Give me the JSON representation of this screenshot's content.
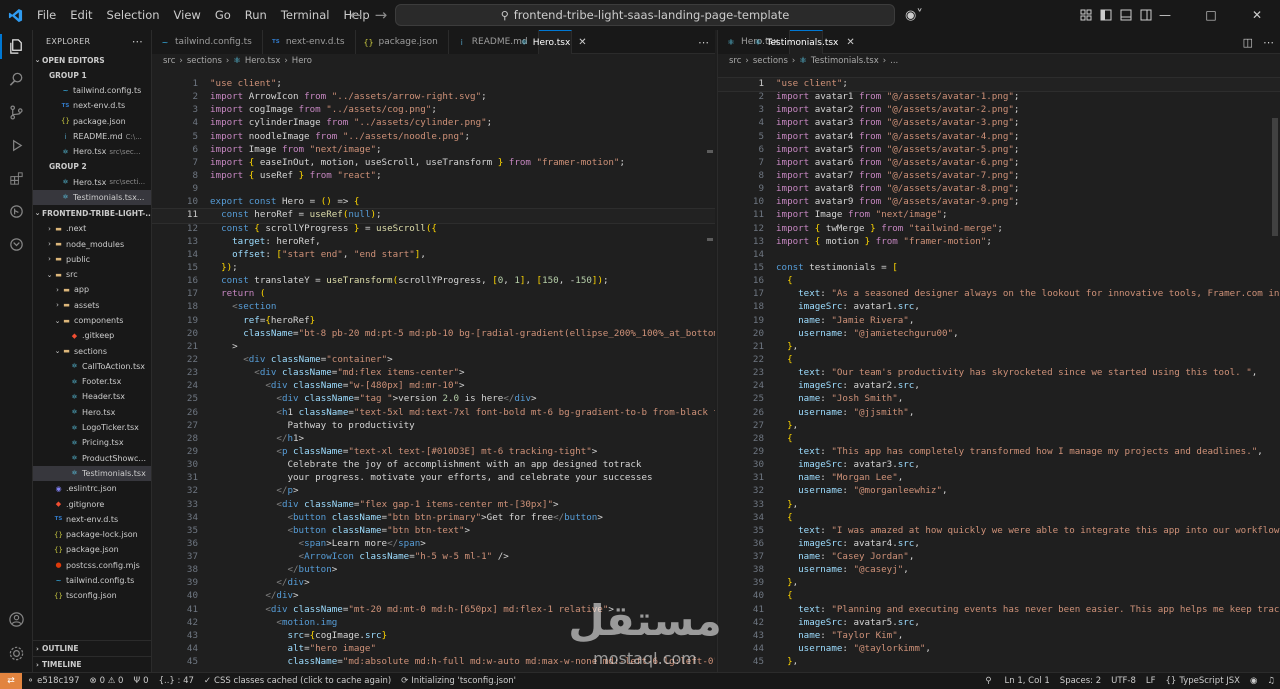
{
  "title_bar": {
    "menu": [
      "File",
      "Edit",
      "Selection",
      "View",
      "Go",
      "Run",
      "Terminal",
      "Help"
    ],
    "search_text": "frontend-tribe-light-saas-landing-page-template"
  },
  "explorer": {
    "title": "EXPLORER",
    "open_editors_label": "OPEN EDITORS",
    "group1_label": "GROUP 1",
    "group2_label": "GROUP 2",
    "project_label": "FRONTEND-TRIBE-LIGHT-...",
    "outline_label": "OUTLINE",
    "timeline_label": "TIMELINE",
    "group1": [
      {
        "name": "tailwind.config.ts",
        "desc": "",
        "icon": "tailwind-icon"
      },
      {
        "name": "next-env.d.ts",
        "desc": "",
        "icon": "typescript-icon"
      },
      {
        "name": "package.json",
        "desc": "",
        "icon": "json-icon"
      },
      {
        "name": "README.md",
        "desc": "C:\\...",
        "icon": "info-icon"
      },
      {
        "name": "Hero.tsx",
        "desc": "src\\sec...",
        "icon": "react-icon"
      }
    ],
    "group2": [
      {
        "name": "Hero.tsx",
        "desc": "src\\secti...",
        "icon": "react-icon"
      },
      {
        "name": "Testimonials.tsx...",
        "desc": "",
        "icon": "react-icon"
      }
    ],
    "tree": [
      {
        "name": ".next",
        "type": "folder",
        "depth": 1,
        "open": false
      },
      {
        "name": "node_modules",
        "type": "folder",
        "depth": 1,
        "open": false
      },
      {
        "name": "public",
        "type": "folder",
        "depth": 1,
        "open": false
      },
      {
        "name": "src",
        "type": "folder",
        "depth": 1,
        "open": true
      },
      {
        "name": "app",
        "type": "folder",
        "depth": 2,
        "open": false
      },
      {
        "name": "assets",
        "type": "folder",
        "depth": 2,
        "open": false
      },
      {
        "name": "components",
        "type": "folder",
        "depth": 2,
        "open": true
      },
      {
        "name": ".gitkeep",
        "type": "file",
        "depth": 3,
        "icon": "git-icon"
      },
      {
        "name": "sections",
        "type": "folder",
        "depth": 2,
        "open": true
      },
      {
        "name": "CallToAction.tsx",
        "type": "file",
        "depth": 3,
        "icon": "react-icon"
      },
      {
        "name": "Footer.tsx",
        "type": "file",
        "depth": 3,
        "icon": "react-icon"
      },
      {
        "name": "Header.tsx",
        "type": "file",
        "depth": 3,
        "icon": "react-icon"
      },
      {
        "name": "Hero.tsx",
        "type": "file",
        "depth": 3,
        "icon": "react-icon"
      },
      {
        "name": "LogoTicker.tsx",
        "type": "file",
        "depth": 3,
        "icon": "react-icon"
      },
      {
        "name": "Pricing.tsx",
        "type": "file",
        "depth": 3,
        "icon": "react-icon"
      },
      {
        "name": "ProductShowc...",
        "type": "file",
        "depth": 3,
        "icon": "react-icon"
      },
      {
        "name": "Testimonials.tsx",
        "type": "file",
        "depth": 3,
        "icon": "react-icon",
        "selected": true
      },
      {
        "name": ".eslintrc.json",
        "type": "file",
        "depth": 1,
        "icon": "eslint-icon"
      },
      {
        "name": ".gitignore",
        "type": "file",
        "depth": 1,
        "icon": "git-icon"
      },
      {
        "name": "next-env.d.ts",
        "type": "file",
        "depth": 1,
        "icon": "typescript-icon"
      },
      {
        "name": "package-lock.json",
        "type": "file",
        "depth": 1,
        "icon": "json-icon"
      },
      {
        "name": "package.json",
        "type": "file",
        "depth": 1,
        "icon": "json-icon"
      },
      {
        "name": "postcss.config.mjs",
        "type": "file",
        "depth": 1,
        "icon": "postcss-icon"
      },
      {
        "name": "tailwind.config.ts",
        "type": "file",
        "depth": 1,
        "icon": "tailwind-icon"
      },
      {
        "name": "tsconfig.json",
        "type": "file",
        "depth": 1,
        "icon": "json-icon"
      }
    ]
  },
  "editor_left": {
    "tabs": [
      {
        "label": "tailwind.config.ts",
        "icon": "tailwind-icon",
        "active": false
      },
      {
        "label": "next-env.d.ts",
        "icon": "typescript-icon",
        "active": false
      },
      {
        "label": "package.json",
        "icon": "json-icon",
        "active": false
      },
      {
        "label": "README.md",
        "icon": "info-icon",
        "active": false
      },
      {
        "label": "Hero.tsx",
        "icon": "react-icon",
        "active": true
      }
    ],
    "breadcrumb": [
      "src",
      "sections",
      "Hero.tsx",
      "Hero"
    ],
    "first_line": 1,
    "current_line": 11,
    "lines": [
      "\"use client\";",
      "import ArrowIcon from \"../assets/arrow-right.svg\";",
      "import cogImage from \"../assets/cog.png\";",
      "import cylinderImage from \"../assets/cylinder.png\";",
      "import noodleImage from \"../assets/noodle.png\";",
      "import Image from \"next/image\";",
      "import { easeInOut, motion, useScroll, useTransform } from \"framer-motion\";",
      "import { useRef } from \"react\";",
      "",
      "export const Hero = () => {",
      "  const heroRef = useRef(null);",
      "  const { scrollYProgress } = useScroll({",
      "    target: heroRef,",
      "    offset: [\"start end\", \"end start\"],",
      "  });",
      "  const translateY = useTransform(scrollYProgress, [0, 1], [150, -150]);",
      "  return (",
      "    <section",
      "      ref={heroRef}",
      "      className=\"bt-8 pb-20 md:pt-5 md:pb-10 bg-[radial-gradient(ellipse_200%_100%_at_bottom_left",
      "    >",
      "      <div className=\"container\">",
      "        <div className=\"md:flex items-center\">",
      "          <div className=\"w-[480px] md:mr-10\">",
      "            <div className=\"tag \">version 2.0 is here</div>",
      "            <h1 className=\"text-5xl md:text-7xl font-bold mt-6 bg-gradient-to-b from-black to-[#0",
      "              Pathway to productivity",
      "            </h1>",
      "            <p className=\"text-xl text-[#010D3E] mt-6 tracking-tight\">",
      "              Celebrate the joy of accomplishment with an app designed totrack",
      "              your progress. motivate your efforts, and celebrate your successes",
      "            </p>",
      "            <div className=\"flex gap-1 items-center mt-[30px]\">",
      "              <button className=\"btn btn-primary\">Get for free</button>",
      "              <button className=\"btn btn-text\">",
      "                <span>Learn more</span>",
      "                <ArrowIcon className=\"h-5 w-5 ml-1\" />",
      "              </button>",
      "            </div>",
      "          </div>",
      "          <div className=\"mt-20 md:mt-0 md:h-[650px] md:flex-1 relative\">",
      "            <motion.img",
      "              src={cogImage.src}",
      "              alt=\"hero image\"",
      "              className=\"md:absolute md:h-full md:w-auto md:max-w-none md:-left-6 lg:left-0\""
    ]
  },
  "editor_right": {
    "tabs": [
      {
        "label": "Hero.tsx",
        "icon": "react-icon",
        "active": false
      },
      {
        "label": "Testimonials.tsx",
        "icon": "react-icon",
        "active": true
      }
    ],
    "breadcrumb": [
      "src",
      "sections",
      "Testimonials.tsx",
      "..."
    ],
    "first_line": 1,
    "current_line": 1,
    "lines": [
      "\"use client\";",
      "import avatar1 from \"@/assets/avatar-1.png\";",
      "import avatar2 from \"@/assets/avatar-2.png\";",
      "import avatar3 from \"@/assets/avatar-3.png\";",
      "import avatar4 from \"@/assets/avatar-4.png\";",
      "import avatar5 from \"@/assets/avatar-5.png\";",
      "import avatar6 from \"@/assets/avatar-6.png\";",
      "import avatar7 from \"@/assets/avatar-7.png\";",
      "import avatar8 from \"@/assets/avatar-8.png\";",
      "import avatar9 from \"@/assets/avatar-9.png\";",
      "import Image from \"next/image\";",
      "import { twMerge } from \"tailwind-merge\";",
      "import { motion } from \"framer-motion\";",
      "",
      "const testimonials = [",
      "  {",
      "    text: \"As a seasoned designer always on the lookout for innovative tools, Framer.com instantl",
      "    imageSrc: avatar1.src,",
      "    name: \"Jamie Rivera\",",
      "    username: \"@jamietechguru00\",",
      "  },",
      "  {",
      "    text: \"Our team's productivity has skyrocketed since we started using this tool. \",",
      "    imageSrc: avatar2.src,",
      "    name: \"Josh Smith\",",
      "    username: \"@jjsmith\",",
      "  },",
      "  {",
      "    text: \"This app has completely transformed how I manage my projects and deadlines.\",",
      "    imageSrc: avatar3.src,",
      "    name: \"Morgan Lee\",",
      "    username: \"@morganleewhiz\",",
      "  },",
      "  {",
      "    text: \"I was amazed at how quickly we were able to integrate this app into our workflow.\",",
      "    imageSrc: avatar4.src,",
      "    name: \"Casey Jordan\",",
      "    username: \"@caseyj\",",
      "  },",
      "  {",
      "    text: \"Planning and executing events has never been easier. This app helps me keep track of a",
      "    imageSrc: avatar5.src,",
      "    name: \"Taylor Kim\",",
      "    username: \"@taylorkimm\",",
      "  },"
    ]
  },
  "status_bar": {
    "branch": "e518c197",
    "problems": "0 ⚠ 0",
    "ports": "0",
    "braces": "{..} : 47",
    "css_message": "CSS classes cached (click to cache again)",
    "init_message": "Initializing 'tsconfig.json'",
    "position": "Ln 1, Col 1",
    "spaces": "Spaces: 2",
    "encoding": "UTF-8",
    "eol": "LF",
    "language": "TypeScript JSX"
  },
  "watermark": "مستقل mostaql.com",
  "colors": {
    "accent": "#0078d4",
    "remote": "#e2843f",
    "background": "#1f1f1f",
    "sidebar": "#181818"
  }
}
